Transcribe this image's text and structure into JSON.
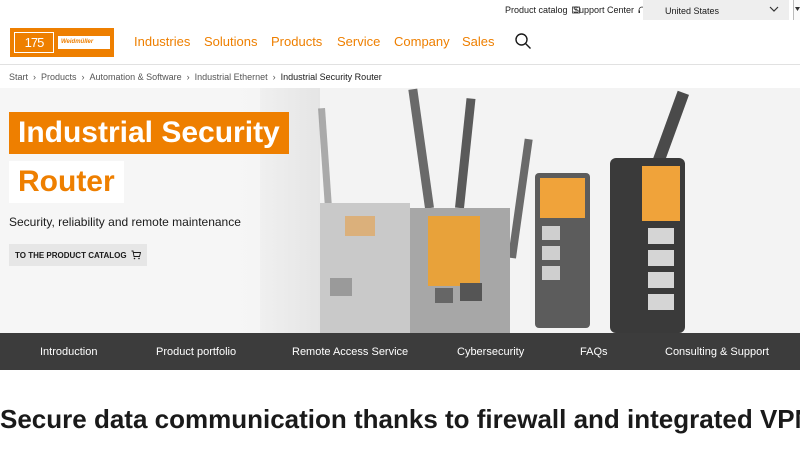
{
  "utility": {
    "product_catalog": "Product catalog",
    "support_center": "Support Center",
    "country": "United States"
  },
  "logo": {
    "number": "175",
    "brand": "Weidmüller"
  },
  "nav": {
    "items": [
      "Industries",
      "Solutions",
      "Products",
      "Service",
      "Company",
      "Sales"
    ]
  },
  "breadcrumb": {
    "items": [
      "Start",
      "Products",
      "Automation & Software",
      "Industrial Ethernet"
    ],
    "current": "Industrial Security Router"
  },
  "hero": {
    "title_line1": "Industrial Security",
    "title_line2": "Router",
    "subtitle": "Security, reliability and remote maintenance",
    "cta_label": "TO THE PRODUCT CATALOG"
  },
  "section_nav": {
    "items": [
      "Introduction",
      "Product portfolio",
      "Remote Access Service",
      "Cybersecurity",
      "FAQs",
      "Consulting & Support"
    ]
  },
  "headline": "Secure data communication thanks to firewall and integrated VPN",
  "colors": {
    "accent": "#ee7f00",
    "dark_bar": "#3c3c3c",
    "hero_bg": "#f3f3f3"
  },
  "icons": {
    "product_catalog": "book-icon",
    "support_center": "headset-icon",
    "country": "chevron-down-icon",
    "search": "search-icon",
    "cta": "cart-icon"
  }
}
